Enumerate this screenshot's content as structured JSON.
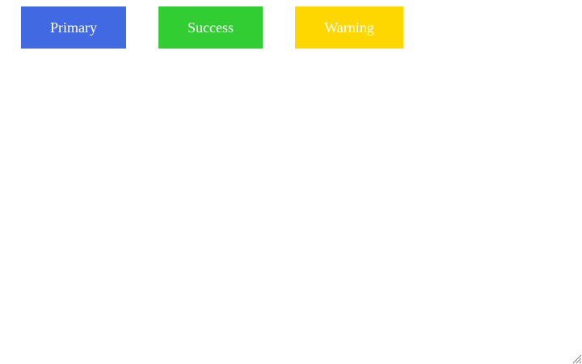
{
  "buttons": [
    {
      "label": "Primary",
      "color": "#4169E1"
    },
    {
      "label": "Success",
      "color": "#32CD32"
    },
    {
      "label": "Warning",
      "color": "#FFD700"
    }
  ],
  "resize_handle": {
    "icon": "resize-grip-icon",
    "color": "#808080"
  }
}
